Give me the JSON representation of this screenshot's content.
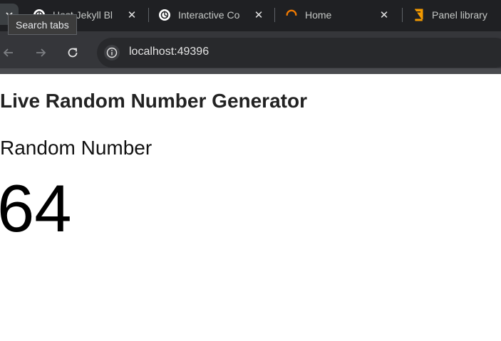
{
  "browser": {
    "search_tabs_tooltip": "Search tabs",
    "tabs": [
      {
        "title": "Host Jekyll Bl",
        "icon": "openai-icon"
      },
      {
        "title": "Interactive Co",
        "icon": "openai-icon"
      },
      {
        "title": "Home",
        "icon": "spinner-icon"
      },
      {
        "title": "Panel library",
        "icon": "book-icon"
      }
    ],
    "url": "localhost:49396"
  },
  "page": {
    "title": "Live Random Number Generator",
    "card_title": "Random Number",
    "value": "64"
  },
  "colors": {
    "chrome_dark": "#1f2023",
    "toolbar": "#35363a",
    "spinner_orange": "#f57c00",
    "book_orange": "#f29900"
  }
}
